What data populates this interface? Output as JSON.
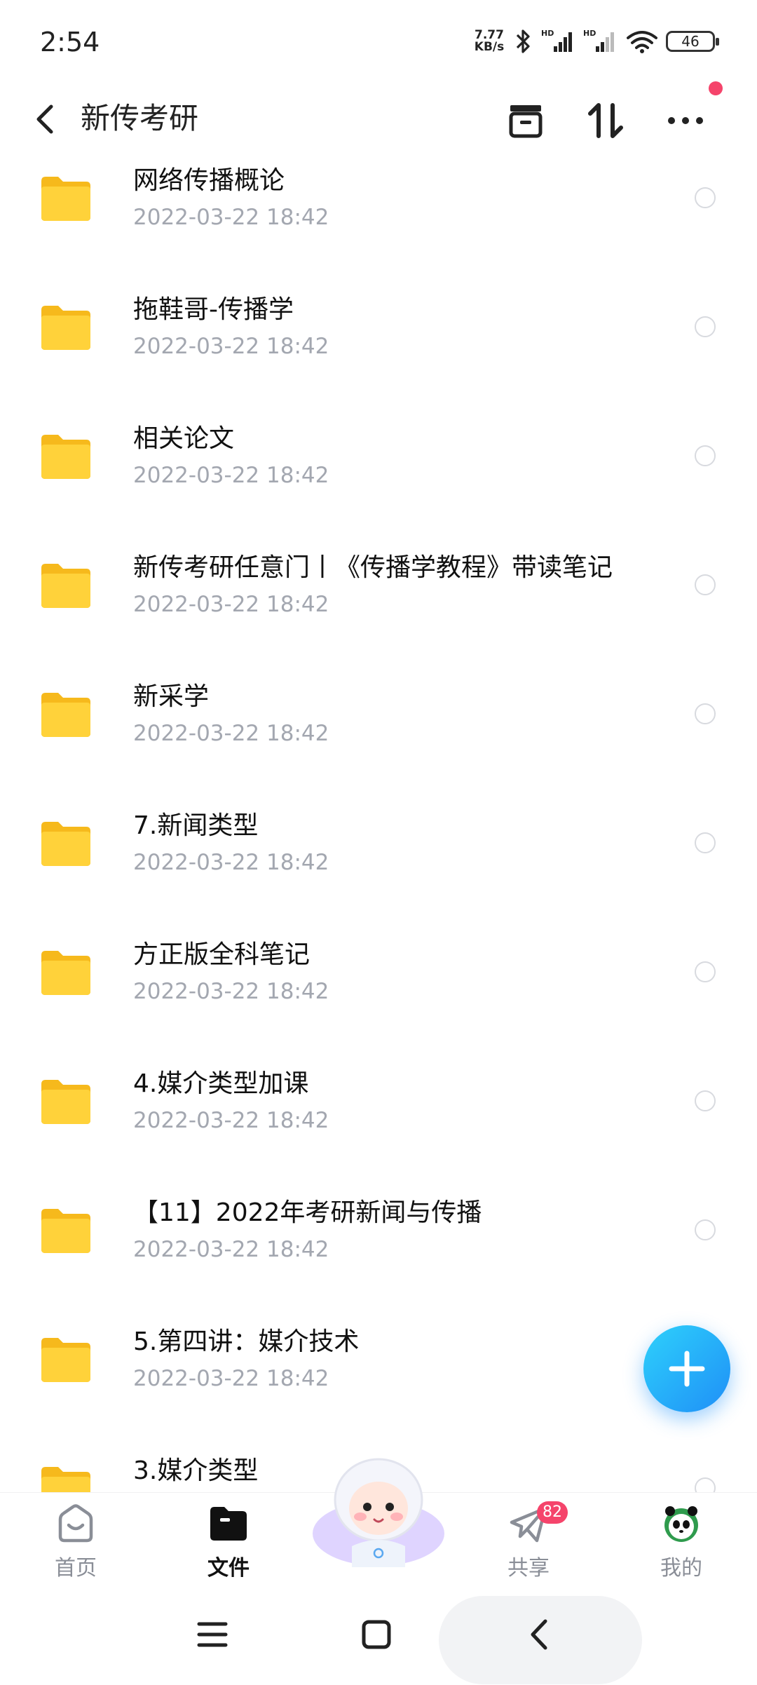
{
  "status_bar": {
    "time": "2:54",
    "net_speed_value": "7.77",
    "net_speed_unit": "KB/s",
    "battery": "46"
  },
  "header": {
    "title": "新传考研",
    "icons": [
      "back-icon",
      "archive-icon",
      "sort-icon",
      "more-icon"
    ]
  },
  "files": [
    {
      "name": "网络传播概论",
      "date": "2022-03-22  18:42"
    },
    {
      "name": "拖鞋哥-传播学",
      "date": "2022-03-22  18:42"
    },
    {
      "name": "相关论文",
      "date": "2022-03-22  18:42"
    },
    {
      "name": "新传考研任意门丨《传播学教程》带读笔记",
      "date": "2022-03-22  18:42"
    },
    {
      "name": "新采学",
      "date": "2022-03-22  18:42"
    },
    {
      "name": "7.新闻类型",
      "date": "2022-03-22  18:42"
    },
    {
      "name": "方正版全科笔记",
      "date": "2022-03-22  18:42"
    },
    {
      "name": "4.媒介类型加课",
      "date": "2022-03-22  18:42"
    },
    {
      "name": "【11】2022年考研新闻与传播",
      "date": "2022-03-22  18:42"
    },
    {
      "name": "5.第四讲：媒介技术",
      "date": "2022-03-22  18:42"
    },
    {
      "name": "3.媒介类型",
      "date": ""
    }
  ],
  "bottom_nav": {
    "home": "首页",
    "files": "文件",
    "share": "共享",
    "share_badge": "82",
    "mine": "我的"
  },
  "colors": {
    "accent_blue": "#1f8ff7",
    "folder_yellow": "#ffcd2e",
    "badge_red": "#f5446b",
    "date_gray": "#a3a7b0"
  }
}
